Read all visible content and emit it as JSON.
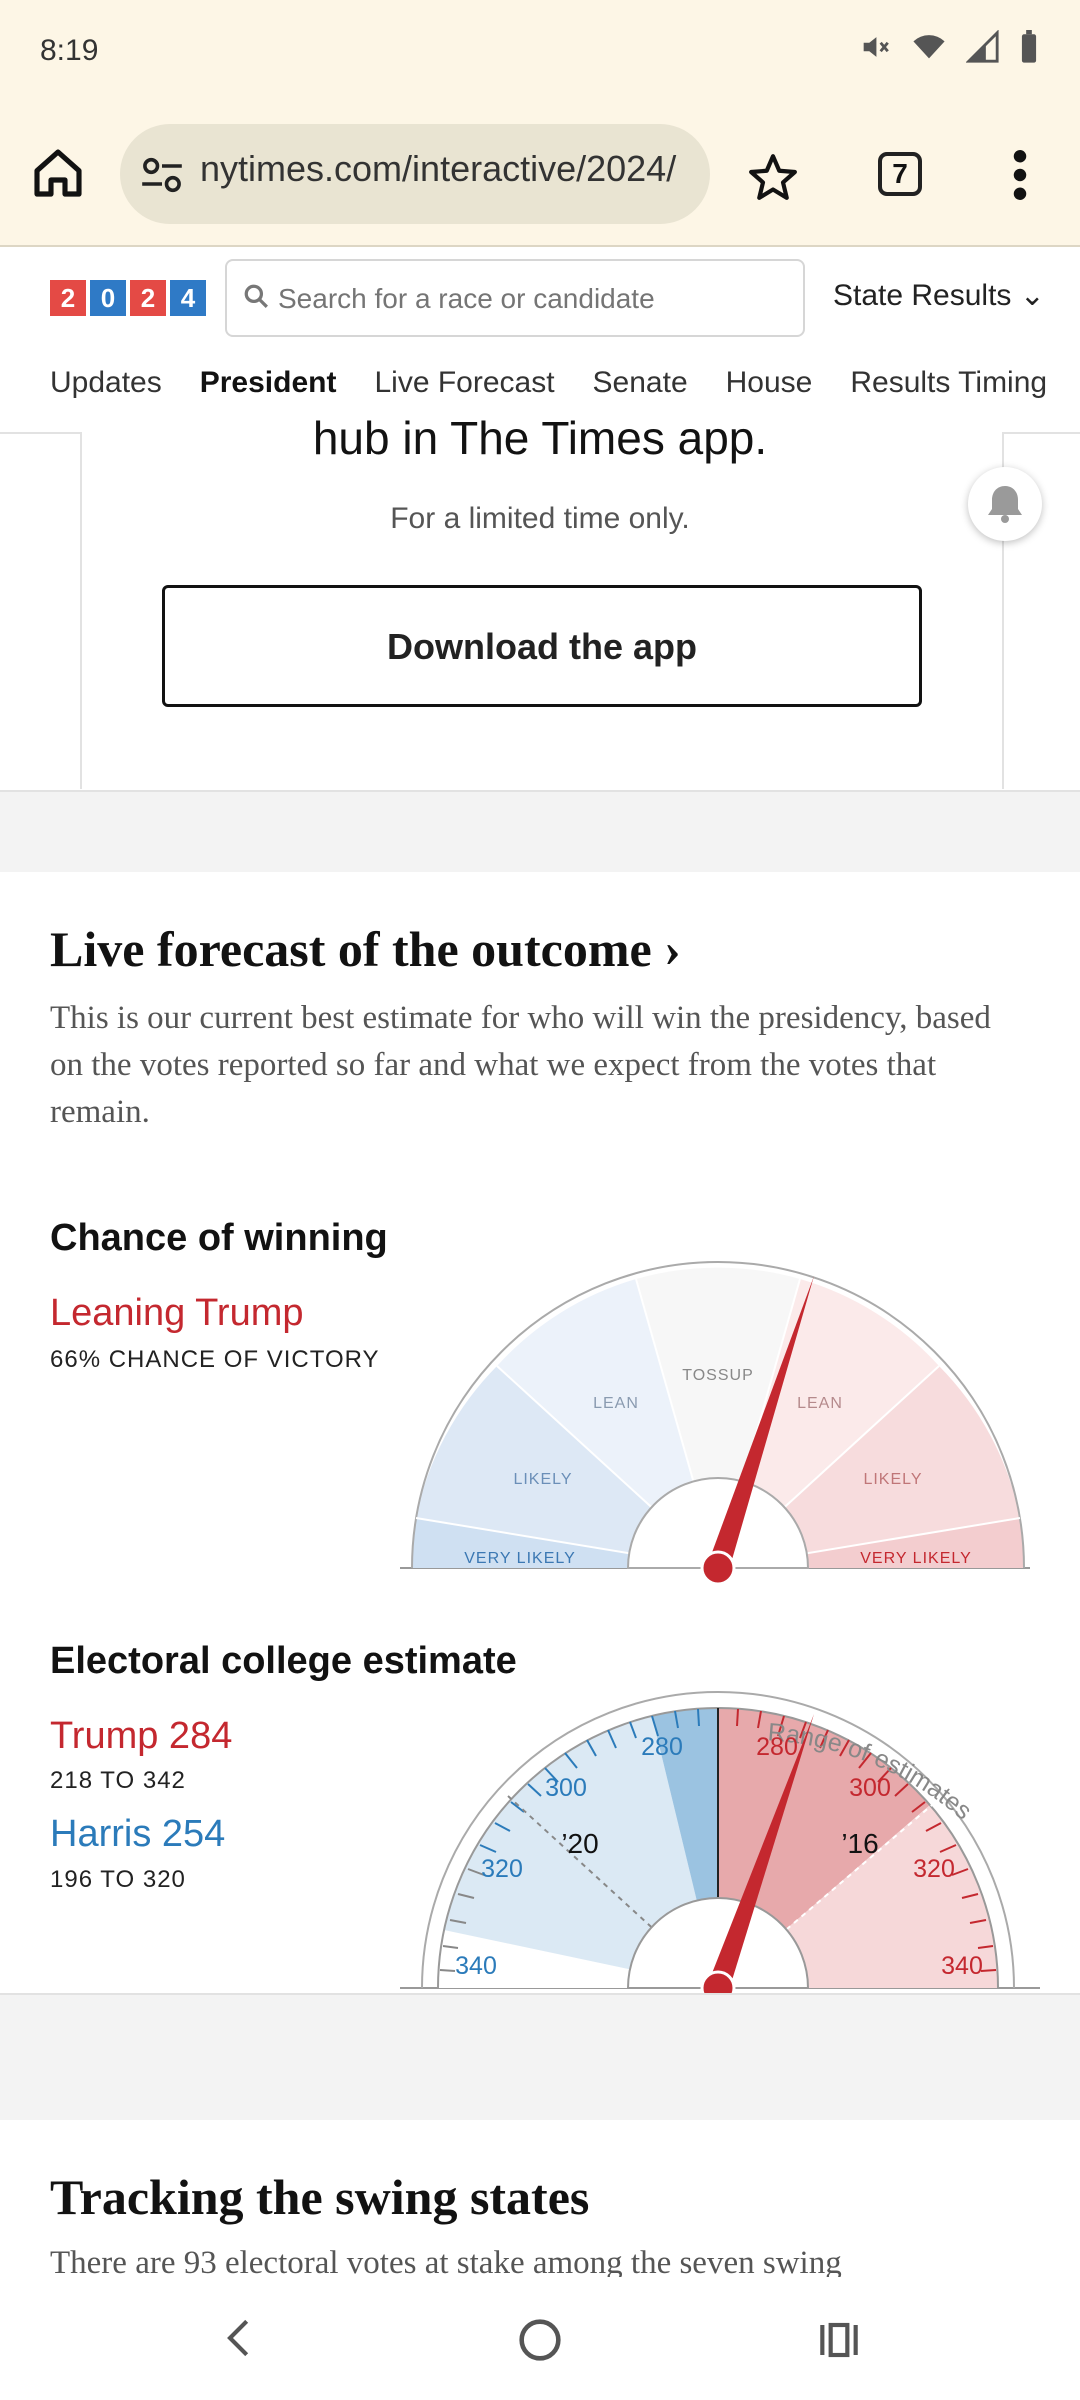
{
  "status": {
    "time": "8:19"
  },
  "browser": {
    "url": "nytimes.com/interactive/2024/",
    "tab_count": "7"
  },
  "header": {
    "logo_digits": [
      "2",
      "0",
      "2",
      "4"
    ],
    "search_placeholder": "Search for a race or candidate",
    "state_results": "State Results ⌄",
    "tabs": [
      {
        "label": "Updates"
      },
      {
        "label": "President",
        "active": true
      },
      {
        "label": "Live Forecast"
      },
      {
        "label": "Senate"
      },
      {
        "label": "House"
      },
      {
        "label": "Results Timing"
      }
    ]
  },
  "promo": {
    "heading": "hub in The Times app.",
    "subheading": "For a limited time only.",
    "button": "Download the app"
  },
  "forecast": {
    "title": "Live forecast of the outcome ›",
    "description": "This is our current best estimate for who will win the presidency, based on the votes reported so far and what we expect from the votes that remain."
  },
  "chance": {
    "title": "Chance of winning",
    "lean_label": "Leaning Trump",
    "subtitle": "66% CHANCE OF VICTORY",
    "gauge_labels": {
      "very_likely_left": "VERY LIKELY",
      "likely_left": "LIKELY",
      "lean_left": "LEAN",
      "tossup": "TOSSUP",
      "lean_right": "LEAN",
      "likely_right": "LIKELY",
      "very_likely_right": "VERY LIKELY"
    }
  },
  "electoral": {
    "title": "Electoral college estimate",
    "trump_label": "Trump 284",
    "trump_range": "218 TO 342",
    "harris_label": "Harris 254",
    "harris_range": "196 TO 320",
    "range_label": "Range of estimates",
    "marker_20": "’20",
    "marker_16": "’16",
    "ticks_left": [
      "280",
      "300",
      "320",
      "340"
    ],
    "ticks_right": [
      "280",
      "300",
      "320",
      "340"
    ]
  },
  "swing": {
    "title": "Tracking the swing states",
    "description": "There are 93 electoral votes at stake among the seven swing"
  },
  "colors": {
    "rep_red": "#c4282f",
    "dem_blue": "#2b7bba",
    "header_bg": "#fdf6e6"
  },
  "icons": [
    "home-icon",
    "tune-icon",
    "star-icon",
    "tabs-icon",
    "more-vert-icon",
    "search-icon",
    "bell-icon",
    "back-icon",
    "home-circle-icon",
    "recents-icon"
  ]
}
